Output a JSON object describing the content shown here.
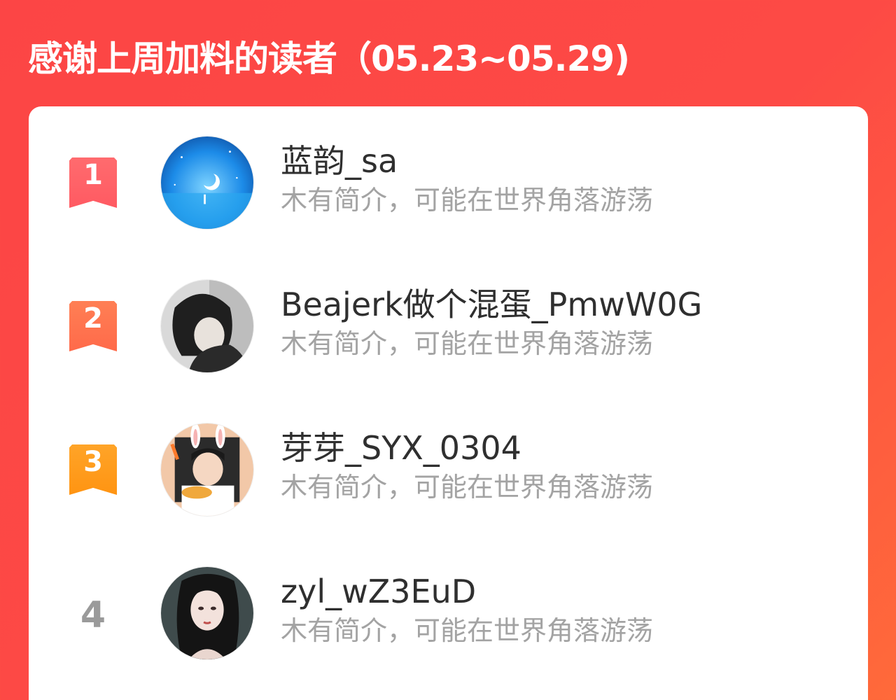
{
  "header": {
    "title": "感谢上周加料的读者（05.23~05.29)"
  },
  "colors": {
    "background": "#fc4545",
    "rank1": "#ff5f63",
    "rank2": "#ff7a4f",
    "rank3": "#ff9a1a",
    "rank_plain": "#9a9a9a",
    "name": "#2f2f2f",
    "bio": "#a3a3a3"
  },
  "readers": [
    {
      "rank": "1",
      "name": "蓝韵_sa",
      "bio": "木有简介，可能在世界角落游荡"
    },
    {
      "rank": "2",
      "name": "Beajerk做个混蛋_PmwW0G",
      "bio": "木有简介，可能在世界角落游荡"
    },
    {
      "rank": "3",
      "name": "芽芽_SYX_0304",
      "bio": "木有简介，可能在世界角落游荡"
    },
    {
      "rank": "4",
      "name": "zyl_wZ3EuD",
      "bio": "木有简介，可能在世界角落游荡"
    }
  ]
}
